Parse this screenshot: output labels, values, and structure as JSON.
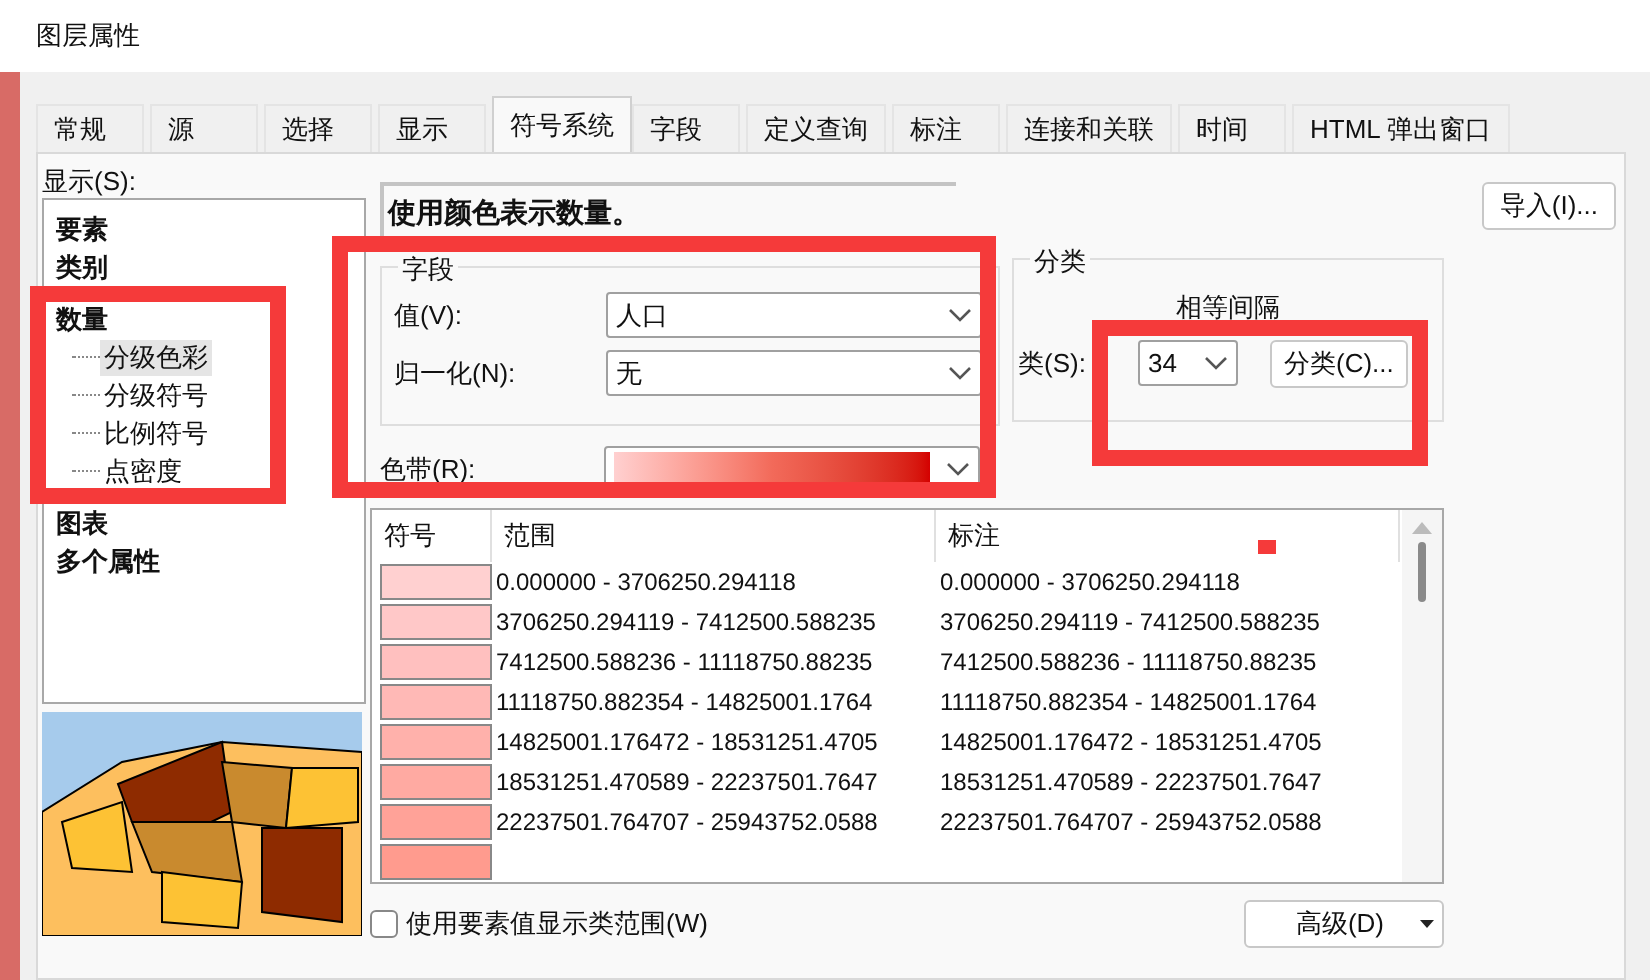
{
  "window": {
    "title": "图层属性"
  },
  "tabs": [
    {
      "label": "常规",
      "selected": false
    },
    {
      "label": "源",
      "selected": false
    },
    {
      "label": "选择",
      "selected": false
    },
    {
      "label": "显示",
      "selected": false
    },
    {
      "label": "符号系统",
      "selected": true
    },
    {
      "label": "字段",
      "selected": false
    },
    {
      "label": "定义查询",
      "selected": false
    },
    {
      "label": "标注",
      "selected": false
    },
    {
      "label": "连接和关联",
      "selected": false
    },
    {
      "label": "时间",
      "selected": false
    },
    {
      "label": "HTML 弹出窗口",
      "selected": false
    }
  ],
  "show_list": {
    "label": "显示(S):",
    "items": [
      {
        "label": "要素",
        "selected": false
      },
      {
        "label": "类别",
        "selected": false
      },
      {
        "label": "数量",
        "selected": false,
        "children": [
          {
            "label": "分级色彩",
            "selected": true
          },
          {
            "label": "分级符号",
            "selected": false
          },
          {
            "label": "比例符号",
            "selected": false
          },
          {
            "label": "点密度",
            "selected": false
          }
        ]
      },
      {
        "label": "图表",
        "selected": false
      },
      {
        "label": "多个属性",
        "selected": false
      }
    ]
  },
  "heading": "使用颜色表示数量。",
  "import_button": "导入(I)...",
  "fields_group": {
    "title": "字段",
    "value_label": "值(V):",
    "value": "人口",
    "normalize_label": "归一化(N):",
    "normalize": "无"
  },
  "color_ramp": {
    "label": "色带(R):"
  },
  "classification": {
    "title": "分类",
    "method": "相等间隔",
    "classes_label": "类(S):",
    "classes": "34",
    "classify_button": "分类(C)..."
  },
  "table": {
    "columns": [
      "符号",
      "范围",
      "标注"
    ],
    "rows": [
      {
        "color": "#ffd0d0",
        "range": "0.000000 - 3706250.294118",
        "label": "0.000000 - 3706250.294118"
      },
      {
        "color": "#ffc8c8",
        "range": "3706250.294119 - 7412500.588235",
        "label": "3706250.294119 - 7412500.588235"
      },
      {
        "color": "#ffc0bf",
        "range": "7412500.588236 - 11118750.88235",
        "label": "7412500.588236 - 11118750.88235"
      },
      {
        "color": "#ffb9b6",
        "range": "11118750.882354 - 14825001.1764",
        "label": "11118750.882354 - 14825001.1764"
      },
      {
        "color": "#ffb1ab",
        "range": "14825001.176472 - 18531251.4705",
        "label": "14825001.176472 - 18531251.4705"
      },
      {
        "color": "#ffaaa2",
        "range": "18531251.470589 - 22237501.7647",
        "label": "18531251.470589 - 22237501.7647"
      },
      {
        "color": "#ffa298",
        "range": "22237501.764707 - 25943752.0588",
        "label": "22237501.764707 - 25943752.0588"
      },
      {
        "color": "#ff9b8e"
      }
    ]
  },
  "show_class_ranges": {
    "label": "使用要素值显示类范围(W)",
    "checked": false
  },
  "advanced_button": "高级(D)"
}
